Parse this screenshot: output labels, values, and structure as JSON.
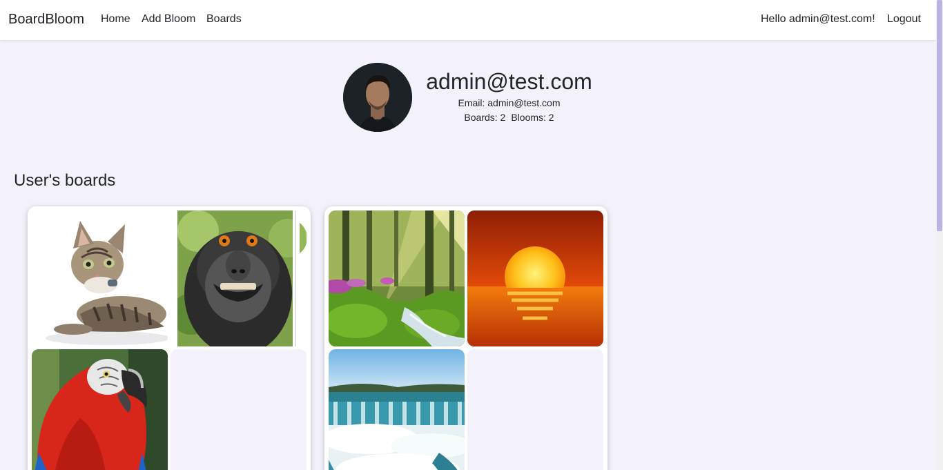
{
  "navbar": {
    "brand": "BoardBloom",
    "links": [
      "Home",
      "Add Bloom",
      "Boards"
    ],
    "greeting": "Hello admin@test.com!",
    "logout": "Logout"
  },
  "profile": {
    "name": "admin@test.com",
    "email_label": "Email: admin@test.com",
    "boards_stat": "Boards: 2",
    "blooms_stat": "Blooms: 2"
  },
  "boards_section": {
    "title": "User's boards"
  },
  "boards": [
    {
      "images": [
        "cat",
        "macaque",
        "macaw"
      ]
    },
    {
      "images": [
        "forest",
        "sunset",
        "waterfall"
      ]
    }
  ],
  "colors": {
    "background": "#f3f2fb",
    "navbar": "#ffffff",
    "text": "#212529",
    "scrollbar_thumb": "#b9b4e4"
  }
}
